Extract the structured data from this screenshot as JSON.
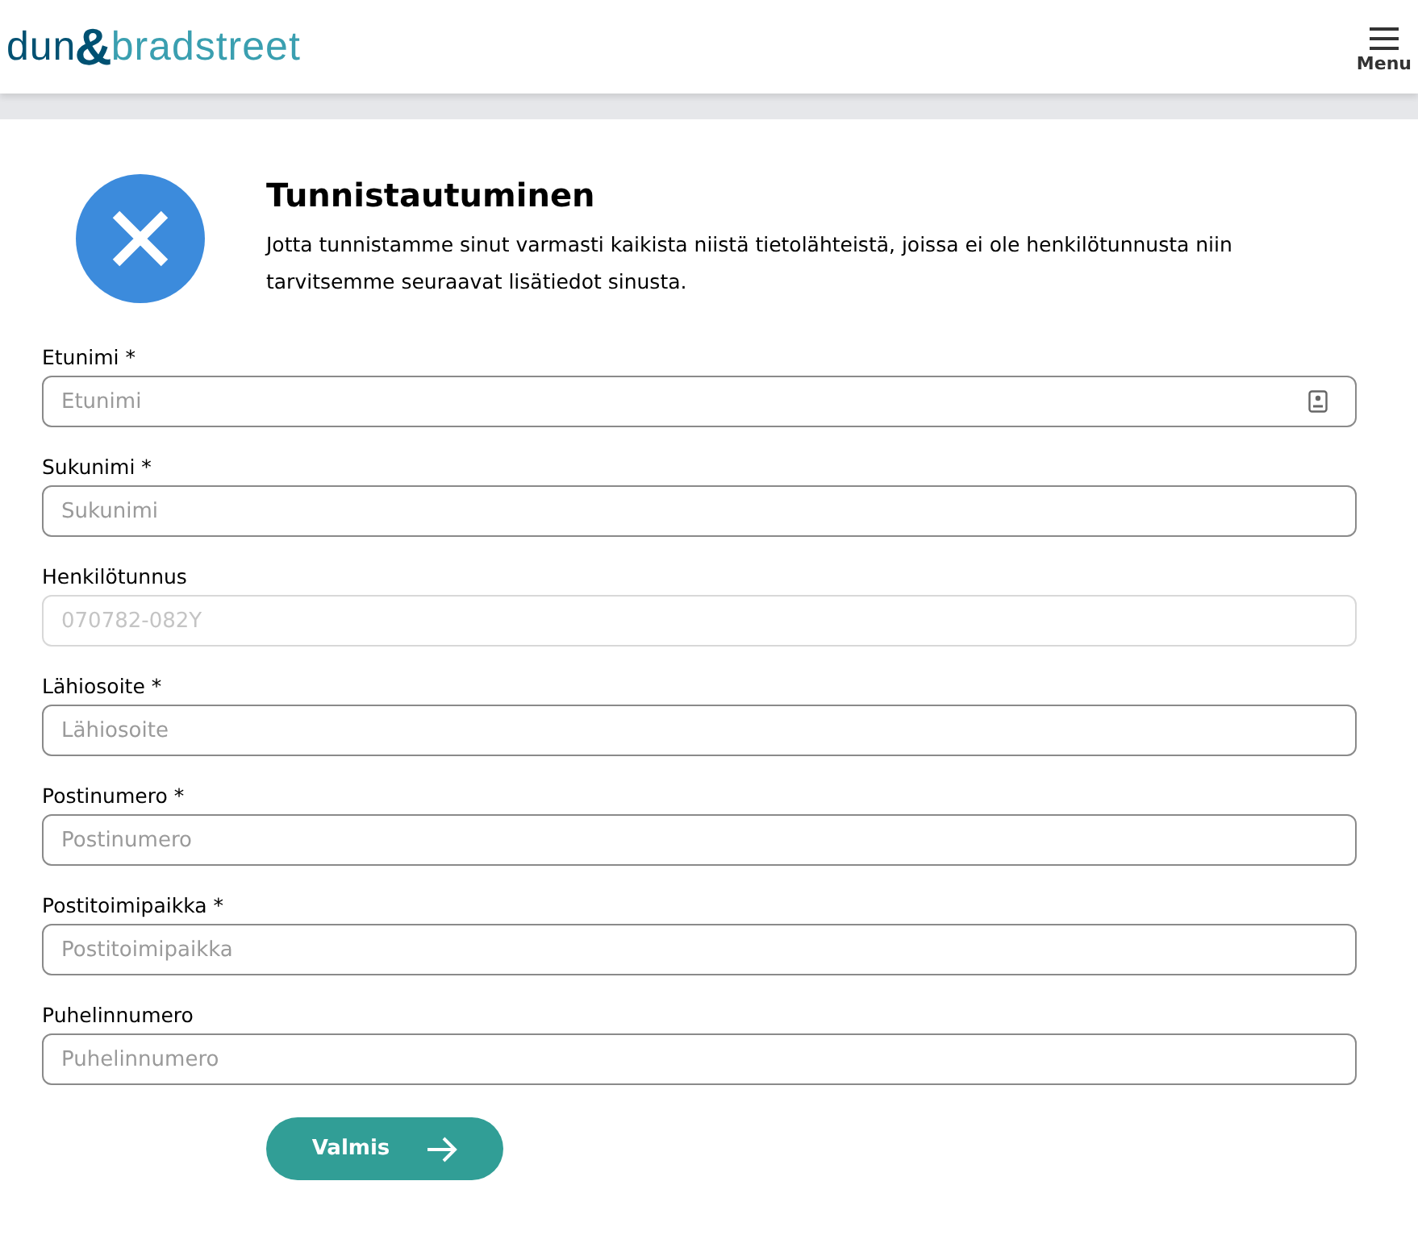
{
  "header": {
    "logo": {
      "first": "dun",
      "ampersand": "&",
      "second": "bradstreet"
    },
    "menu_label": "Menu"
  },
  "intro": {
    "title": "Tunnistautuminen",
    "text": "Jotta tunnistamme sinut varmasti kaikista niistä tietolähteistä, joissa ei ole henkilötunnusta niin tarvitsemme seuraavat lisätiedot sinusta."
  },
  "fields": [
    {
      "label": "Etunimi *",
      "placeholder": "Etunimi",
      "disabled": false,
      "kind": "autofill"
    },
    {
      "label": "Sukunimi *",
      "placeholder": "Sukunimi",
      "disabled": false,
      "kind": "text"
    },
    {
      "label": "Henkilötunnus",
      "placeholder": "070782-082Y",
      "disabled": true,
      "kind": "text"
    },
    {
      "label": "Lähiosoite *",
      "placeholder": "Lähiosoite",
      "disabled": false,
      "kind": "text"
    },
    {
      "label": "Postinumero *",
      "placeholder": "Postinumero",
      "disabled": false,
      "kind": "text"
    },
    {
      "label": "Postitoimipaikka *",
      "placeholder": "Postitoimipaikka",
      "disabled": false,
      "kind": "text"
    },
    {
      "label": "Puhelinnumero",
      "placeholder": "Puhelinnumero",
      "disabled": false,
      "kind": "text"
    }
  ],
  "submit": {
    "label": "Valmis"
  }
}
